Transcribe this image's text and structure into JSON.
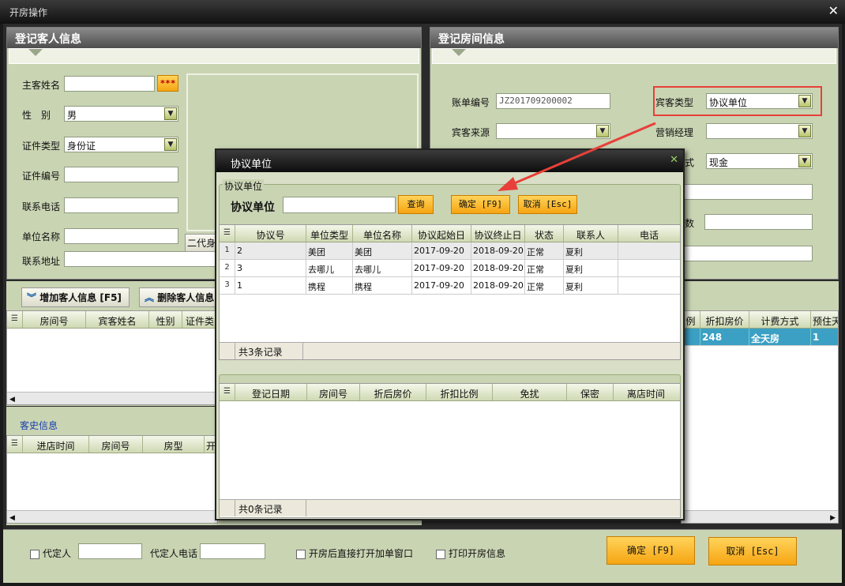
{
  "window": {
    "title": "开房操作"
  },
  "guest_panel": {
    "title": "登记客人信息",
    "name_label": "主客姓名",
    "name_value": "",
    "star_btn": "***",
    "gender_label": "性　别",
    "gender_value": "男",
    "idtype_label": "证件类型",
    "idtype_value": "身份证",
    "idno_label": "证件编号",
    "idno_value": "",
    "phone_label": "联系电话",
    "phone_value": "",
    "unit_label": "单位名称",
    "unit_value": "",
    "addr_label": "联系地址",
    "addr_value": "",
    "idcard_text": "二代身"
  },
  "room_panel": {
    "title": "登记房间信息",
    "bill_label": "账单编号",
    "bill_value": "JZ201709200002",
    "guesttype_label": "宾客类型",
    "guesttype_value": "协议单位",
    "source_label": "宾客来源",
    "source_value": "",
    "manager_label": "营销经理",
    "manager_value": "",
    "pay_label_partial": "式",
    "pay_value": "现金",
    "count_label_partial": "数"
  },
  "guest_actions": {
    "add": "增加客人信息 [F5]",
    "del": "删除客人信息"
  },
  "guest_grid": {
    "cols": [
      "房间号",
      "宾客姓名",
      "性别",
      "证件类"
    ]
  },
  "room_grid": {
    "cols": [
      "例",
      "折扣房价",
      "计费方式",
      "预住天"
    ],
    "row": {
      "rate": "248",
      "mode": "全天房",
      "days": "1"
    }
  },
  "history": {
    "title": "客史信息",
    "cols": [
      "进店时间",
      "房间号",
      "房型",
      "开"
    ]
  },
  "bottom": {
    "agent_label": "代定人",
    "agent_value": "",
    "agent_phone_label": "代定人电话",
    "agent_phone_value": "",
    "open_window_label": "开房后直接打开加单窗口",
    "print_label": "打印开房信息",
    "ok": "确定 [F9]",
    "cancel": "取消 [Esc]"
  },
  "dialog": {
    "title": "协议单位",
    "group_label": "协议单位",
    "search_label": "协议单位",
    "search_value": "",
    "query_btn": "查询",
    "ok_btn": "确定 [F9]",
    "cancel_btn": "取消 [Esc]",
    "cols": [
      "协议号",
      "单位类型",
      "单位名称",
      "协议起始日",
      "协议终止日",
      "状态",
      "联系人",
      "电话"
    ],
    "rows": [
      [
        "1",
        "2",
        "美团",
        "美团",
        "2017-09-20",
        "2018-09-20",
        "正常",
        "夏利",
        ""
      ],
      [
        "2",
        "3",
        "去哪儿",
        "去哪儿",
        "2017-09-20",
        "2018-09-20",
        "正常",
        "夏利",
        ""
      ],
      [
        "3",
        "1",
        "携程",
        "携程",
        "2017-09-20",
        "2018-09-20",
        "正常",
        "夏利",
        ""
      ]
    ],
    "count1": "共3条记录",
    "cols2": [
      "登记日期",
      "房间号",
      "折后房价",
      "折扣比例",
      "免扰",
      "保密",
      "离店时间"
    ],
    "count2": "共0条记录"
  },
  "colors": {
    "annotation": "#e8403a",
    "orange": "#f6a512",
    "panel": "#c9d4b3",
    "selected": "#3ba0c4"
  }
}
